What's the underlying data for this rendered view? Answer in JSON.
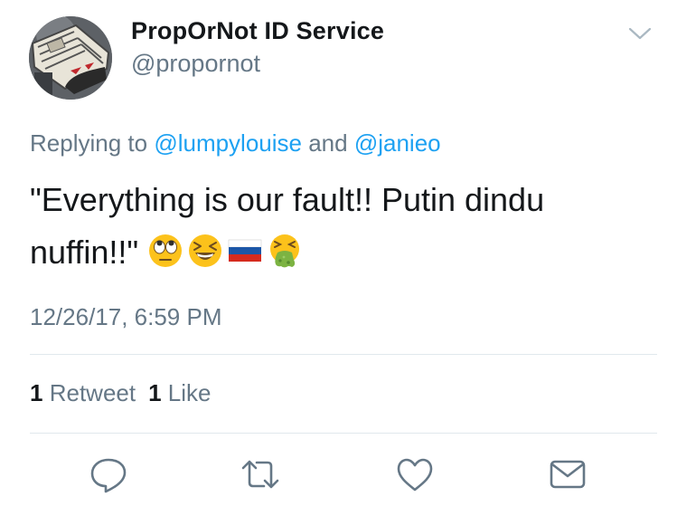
{
  "author": {
    "display_name": "PropOrNot ID Service",
    "handle": "@propornot"
  },
  "reply": {
    "prefix": "Replying to ",
    "user1": "@lumpylouise",
    "conjunction": " and ",
    "user2": "@janieo"
  },
  "tweet": {
    "text": "\"Everything is our fault!! Putin dindu nuffin!!\"",
    "emojis": [
      "face-with-rolling-eyes",
      "grinning-squinting-face",
      "flag-russia",
      "face-vomiting"
    ]
  },
  "timestamp": "12/26/17, 6:59 PM",
  "stats": {
    "retweet_count": "1",
    "retweet_label": "Retweet",
    "like_count": "1",
    "like_label": "Like"
  },
  "actions": [
    "reply-icon",
    "retweet-icon",
    "like-icon",
    "direct-message-icon"
  ],
  "colors": {
    "link": "#1da1f2",
    "muted": "#657786",
    "text": "#14171a",
    "divider": "#e1e8ed"
  }
}
